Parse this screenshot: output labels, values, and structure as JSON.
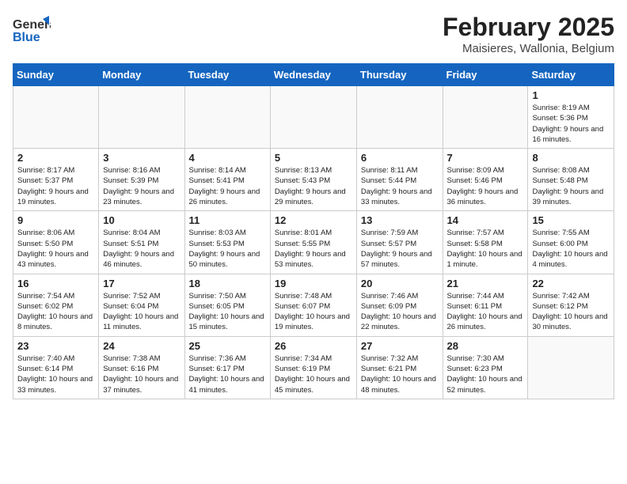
{
  "header": {
    "logo_general": "General",
    "logo_blue": "Blue",
    "month_title": "February 2025",
    "subtitle": "Maisieres, Wallonia, Belgium"
  },
  "days_of_week": [
    "Sunday",
    "Monday",
    "Tuesday",
    "Wednesday",
    "Thursday",
    "Friday",
    "Saturday"
  ],
  "weeks": [
    [
      {
        "day": "",
        "info": ""
      },
      {
        "day": "",
        "info": ""
      },
      {
        "day": "",
        "info": ""
      },
      {
        "day": "",
        "info": ""
      },
      {
        "day": "",
        "info": ""
      },
      {
        "day": "",
        "info": ""
      },
      {
        "day": "1",
        "info": "Sunrise: 8:19 AM\nSunset: 5:36 PM\nDaylight: 9 hours and 16 minutes."
      }
    ],
    [
      {
        "day": "2",
        "info": "Sunrise: 8:17 AM\nSunset: 5:37 PM\nDaylight: 9 hours and 19 minutes."
      },
      {
        "day": "3",
        "info": "Sunrise: 8:16 AM\nSunset: 5:39 PM\nDaylight: 9 hours and 23 minutes."
      },
      {
        "day": "4",
        "info": "Sunrise: 8:14 AM\nSunset: 5:41 PM\nDaylight: 9 hours and 26 minutes."
      },
      {
        "day": "5",
        "info": "Sunrise: 8:13 AM\nSunset: 5:43 PM\nDaylight: 9 hours and 29 minutes."
      },
      {
        "day": "6",
        "info": "Sunrise: 8:11 AM\nSunset: 5:44 PM\nDaylight: 9 hours and 33 minutes."
      },
      {
        "day": "7",
        "info": "Sunrise: 8:09 AM\nSunset: 5:46 PM\nDaylight: 9 hours and 36 minutes."
      },
      {
        "day": "8",
        "info": "Sunrise: 8:08 AM\nSunset: 5:48 PM\nDaylight: 9 hours and 39 minutes."
      }
    ],
    [
      {
        "day": "9",
        "info": "Sunrise: 8:06 AM\nSunset: 5:50 PM\nDaylight: 9 hours and 43 minutes."
      },
      {
        "day": "10",
        "info": "Sunrise: 8:04 AM\nSunset: 5:51 PM\nDaylight: 9 hours and 46 minutes."
      },
      {
        "day": "11",
        "info": "Sunrise: 8:03 AM\nSunset: 5:53 PM\nDaylight: 9 hours and 50 minutes."
      },
      {
        "day": "12",
        "info": "Sunrise: 8:01 AM\nSunset: 5:55 PM\nDaylight: 9 hours and 53 minutes."
      },
      {
        "day": "13",
        "info": "Sunrise: 7:59 AM\nSunset: 5:57 PM\nDaylight: 9 hours and 57 minutes."
      },
      {
        "day": "14",
        "info": "Sunrise: 7:57 AM\nSunset: 5:58 PM\nDaylight: 10 hours and 1 minute."
      },
      {
        "day": "15",
        "info": "Sunrise: 7:55 AM\nSunset: 6:00 PM\nDaylight: 10 hours and 4 minutes."
      }
    ],
    [
      {
        "day": "16",
        "info": "Sunrise: 7:54 AM\nSunset: 6:02 PM\nDaylight: 10 hours and 8 minutes."
      },
      {
        "day": "17",
        "info": "Sunrise: 7:52 AM\nSunset: 6:04 PM\nDaylight: 10 hours and 11 minutes."
      },
      {
        "day": "18",
        "info": "Sunrise: 7:50 AM\nSunset: 6:05 PM\nDaylight: 10 hours and 15 minutes."
      },
      {
        "day": "19",
        "info": "Sunrise: 7:48 AM\nSunset: 6:07 PM\nDaylight: 10 hours and 19 minutes."
      },
      {
        "day": "20",
        "info": "Sunrise: 7:46 AM\nSunset: 6:09 PM\nDaylight: 10 hours and 22 minutes."
      },
      {
        "day": "21",
        "info": "Sunrise: 7:44 AM\nSunset: 6:11 PM\nDaylight: 10 hours and 26 minutes."
      },
      {
        "day": "22",
        "info": "Sunrise: 7:42 AM\nSunset: 6:12 PM\nDaylight: 10 hours and 30 minutes."
      }
    ],
    [
      {
        "day": "23",
        "info": "Sunrise: 7:40 AM\nSunset: 6:14 PM\nDaylight: 10 hours and 33 minutes."
      },
      {
        "day": "24",
        "info": "Sunrise: 7:38 AM\nSunset: 6:16 PM\nDaylight: 10 hours and 37 minutes."
      },
      {
        "day": "25",
        "info": "Sunrise: 7:36 AM\nSunset: 6:17 PM\nDaylight: 10 hours and 41 minutes."
      },
      {
        "day": "26",
        "info": "Sunrise: 7:34 AM\nSunset: 6:19 PM\nDaylight: 10 hours and 45 minutes."
      },
      {
        "day": "27",
        "info": "Sunrise: 7:32 AM\nSunset: 6:21 PM\nDaylight: 10 hours and 48 minutes."
      },
      {
        "day": "28",
        "info": "Sunrise: 7:30 AM\nSunset: 6:23 PM\nDaylight: 10 hours and 52 minutes."
      },
      {
        "day": "",
        "info": ""
      }
    ]
  ]
}
